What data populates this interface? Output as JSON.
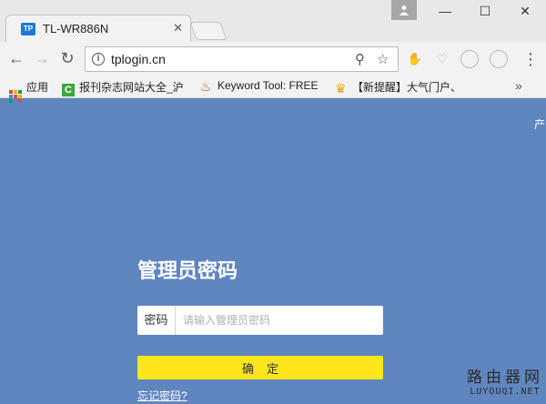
{
  "browser": {
    "tab": {
      "favicon_text": "TP",
      "title": "TL-WR886N",
      "close_glyph": "✕"
    },
    "window_controls": {
      "minimize": "—",
      "maximize": "☐",
      "close": "✕"
    },
    "toolbar": {
      "back": "←",
      "forward": "→",
      "reload": "↻",
      "url": "tplogin.cn",
      "info_glyph": "i",
      "zoom_glyph": "⚲",
      "star_glyph": "☆",
      "menu_glyph": "⋮"
    },
    "bookmarks": [
      {
        "label": "应用",
        "icon": "apps-grid-icon"
      },
      {
        "label": "报刊杂志网站大全_沪",
        "icon": "green-c-icon"
      },
      {
        "label": "Keyword Tool: FREE",
        "icon": "flame-icon"
      },
      {
        "label": "【新提醒】大气门户、",
        "icon": "trophy-icon"
      }
    ],
    "bookmarks_overflow": "»"
  },
  "page": {
    "corner_text": "产",
    "title": "管理员密码",
    "password": {
      "label": "密码",
      "placeholder": "请输入管理员密码",
      "value": ""
    },
    "confirm_label": "确定",
    "forgot_link": "忘记密码?"
  },
  "watermark": {
    "top": "路由器网",
    "bottom": "LUYOUQI.NET"
  },
  "colors": {
    "page_bg": "#6086c0",
    "button_yellow": "#fde61b",
    "favicon_blue": "#1a7bd6"
  }
}
